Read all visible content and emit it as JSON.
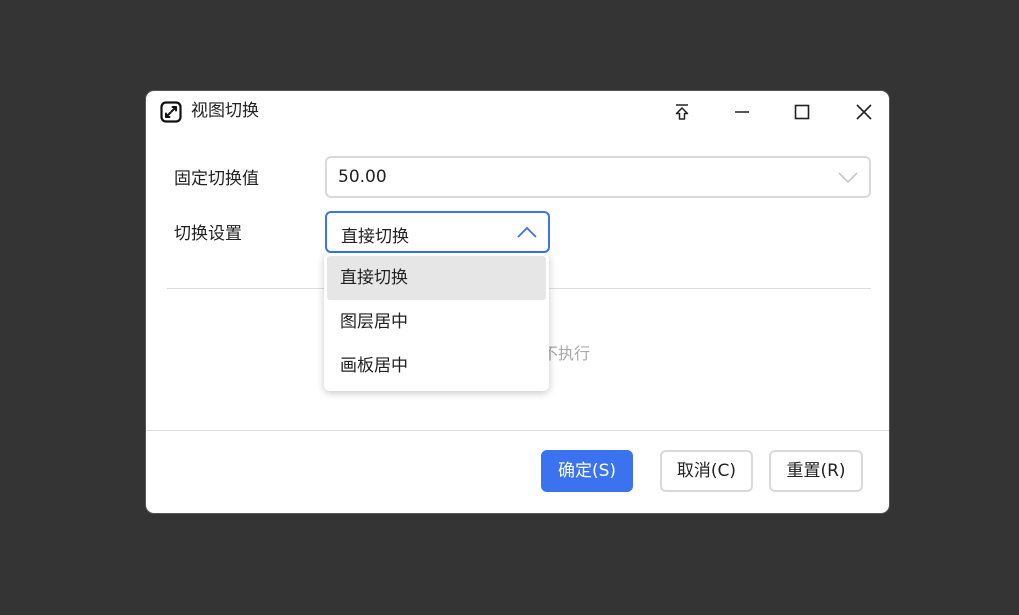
{
  "dialog": {
    "title": "视图切换",
    "icon": "expand-arrows-icon",
    "window_controls": [
      "pin-icon",
      "minimize-icon",
      "maximize-icon",
      "close-icon"
    ]
  },
  "form": {
    "fixed_value_label": "固定切换值",
    "fixed_value": "50.00",
    "switch_setting_label": "切换设置",
    "switch_setting_value": "直接切换",
    "hint_text": "不执行"
  },
  "dropdown": {
    "options": [
      {
        "label": "直接切换",
        "selected": true
      },
      {
        "label": "图层居中",
        "selected": false
      },
      {
        "label": "画板居中",
        "selected": false
      }
    ]
  },
  "buttons": {
    "confirm": "确定(S)",
    "cancel": "取消(C)",
    "reset": "重置(R)"
  },
  "colors": {
    "accent": "#3a72f0",
    "background": "#343434"
  }
}
